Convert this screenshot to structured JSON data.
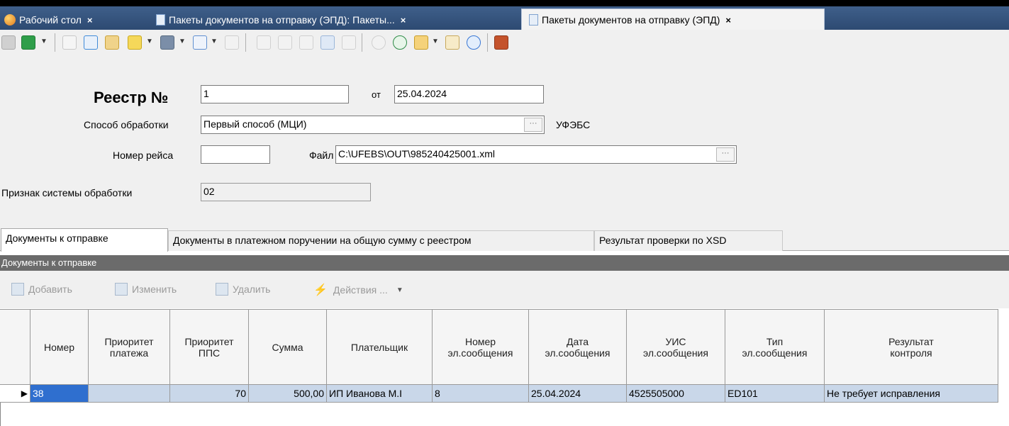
{
  "tabs": [
    {
      "label": "Рабочий стол",
      "close": "×"
    },
    {
      "label": "Пакеты документов на отправку (ЭПД): Пакеты...",
      "close": "×"
    },
    {
      "label": "Пакеты документов на отправку (ЭПД)",
      "close": "×"
    }
  ],
  "form": {
    "registry_label": "Реестр №",
    "registry_number": "1",
    "from_label": "от",
    "date": "25.04.2024",
    "method_label": "Способ обработки",
    "method_value": "Первый способ (МЦИ)",
    "method_code": "УФЭБС",
    "flight_label": "Номер рейса",
    "flight_value": "",
    "file_label": "Файл",
    "file_value": "C:\\UFEBS\\OUT\\985240425001.xml",
    "system_label": "Признак системы обработки",
    "system_value": "02",
    "ellipsis": "···"
  },
  "page_tabs": [
    "Документы к отправке",
    "Документы в платежном поручении на общую сумму с реестром",
    "Результат проверки по XSD"
  ],
  "section_title": "Документы к отправке",
  "actions": {
    "add": "Добавить",
    "edit": "Изменить",
    "delete": "Удалить",
    "more": "Действия ...",
    "more_arrow": "▼"
  },
  "grid": {
    "columns": [
      "Номер",
      "Приоритет платежа",
      "Приоритет ППС",
      "Сумма",
      "Плательщик",
      "Номер эл.сообщения",
      "Дата эл.сообщения",
      "УИС эл.сообщения",
      "Тип эл.сообщения",
      "Результат контроля"
    ],
    "rows": [
      {
        "marker": "▶",
        "number": "38",
        "priority_payment": "",
        "priority_pps": "70",
        "amount": "500,00",
        "payer": "ИП Иванова М.І",
        "msg_number": "8",
        "msg_date": "25.04.2024",
        "uis": "4525505000",
        "msg_type": "ED101",
        "control_result": "Не требует исправления"
      }
    ]
  },
  "colors": {
    "tabstrip": "#35537b",
    "section_bar": "#6b6b6b",
    "row_selected": "#c9d7e9",
    "cell_current": "#2f6fcf"
  }
}
